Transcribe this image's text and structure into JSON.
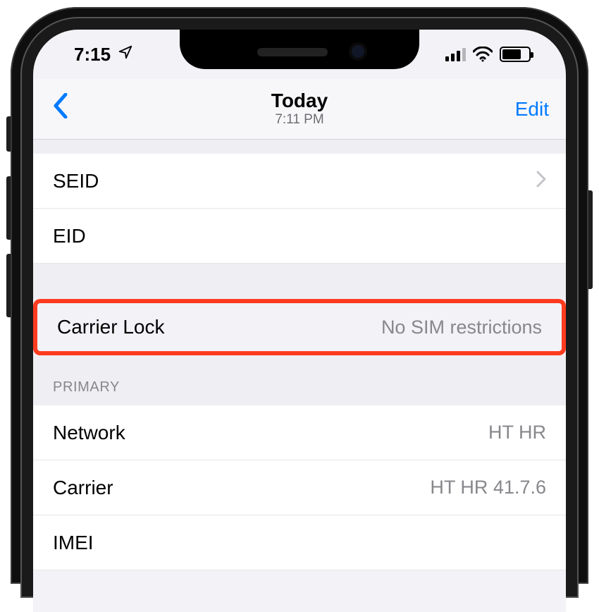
{
  "status": {
    "time": "7:15"
  },
  "nav": {
    "title": "Today",
    "subtitle": "7:11 PM",
    "edit": "Edit"
  },
  "rows": {
    "seid": {
      "label": "SEID"
    },
    "eid": {
      "label": "EID"
    },
    "carrier_lock": {
      "label": "Carrier Lock",
      "value": "No SIM restrictions"
    }
  },
  "section": {
    "primary": "PRIMARY"
  },
  "primary_rows": {
    "network": {
      "label": "Network",
      "value": "HT HR"
    },
    "carrier": {
      "label": "Carrier",
      "value": "HT HR 41.7.6"
    },
    "imei": {
      "label": "IMEI"
    }
  }
}
